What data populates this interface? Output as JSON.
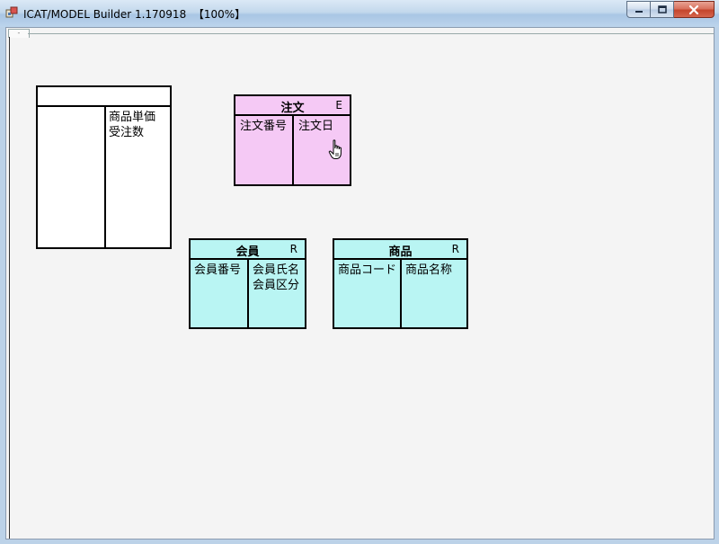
{
  "window": {
    "title": "ICAT/MODEL Builder 1.170918  【100%】",
    "minimize_label": "",
    "maximize_label": "",
    "close_label": "",
    "tab_stub_label": "-"
  },
  "entities": {
    "unnamed": {
      "name": "",
      "tag": "",
      "attributes": [
        "商品単価",
        "受注数"
      ]
    },
    "order": {
      "name": "注文",
      "tag": "E",
      "keys": [
        "注文番号"
      ],
      "attributes": [
        "注文日"
      ]
    },
    "member": {
      "name": "会員",
      "tag": "R",
      "keys": [
        "会員番号"
      ],
      "attributes": [
        "会員氏名",
        "会員区分"
      ]
    },
    "product": {
      "name": "商品",
      "tag": "R",
      "keys": [
        "商品コード"
      ],
      "attributes": [
        "商品名称"
      ]
    }
  },
  "colors": {
    "event_entity": "#f5c9f5",
    "resource_entity": "#b9f5f3",
    "canvas": "#f4f4f4"
  },
  "icons": {
    "app": "app-icon",
    "cursor": "hand-pointer-icon"
  }
}
